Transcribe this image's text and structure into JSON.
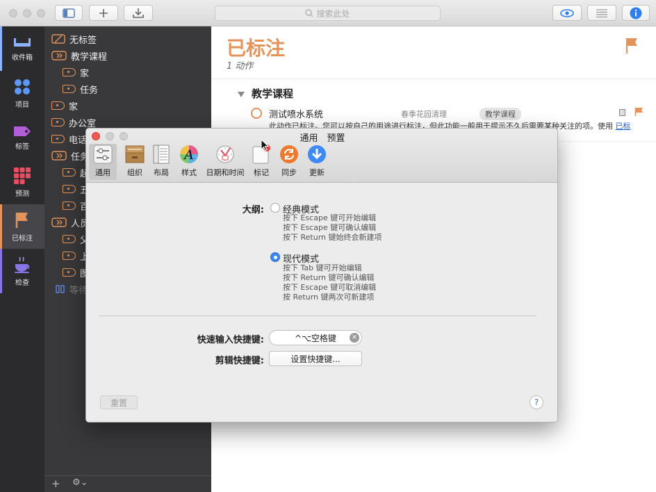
{
  "toolbar": {
    "search_placeholder": "搜索此处",
    "icons": [
      "sidebar-toggle-icon",
      "plus-icon",
      "inbox-download-icon",
      "eye-icon",
      "list-icon",
      "info-icon"
    ],
    "accent": "#2f7ff0"
  },
  "rail": {
    "items": [
      {
        "label": "收件箱",
        "icon": "inbox-icon",
        "color": "#8fb4ff"
      },
      {
        "label": "项目",
        "icon": "projects-icon",
        "color": "#5a97f7"
      },
      {
        "label": "标签",
        "icon": "tag-icon",
        "color": "#b45dd9"
      },
      {
        "label": "预测",
        "icon": "forecast-icon",
        "color": "#e84d63"
      },
      {
        "label": "已标注",
        "icon": "flag-icon",
        "color": "#e4935a"
      },
      {
        "label": "检查",
        "icon": "review-icon",
        "color": "#8a75e6"
      }
    ]
  },
  "sidebar": {
    "items": [
      {
        "label": "无标签"
      },
      {
        "label": "教学课程"
      },
      {
        "label": "家"
      },
      {
        "label": "任务"
      },
      {
        "label": "家"
      },
      {
        "label": "办公室"
      },
      {
        "label": "电话"
      },
      {
        "label": "任务"
      },
      {
        "label": "起"
      },
      {
        "label": "五"
      },
      {
        "label": "百"
      },
      {
        "label": "人员"
      },
      {
        "label": "父"
      },
      {
        "label": "上"
      },
      {
        "label": "图"
      },
      {
        "label": "等待"
      }
    ],
    "footer_add": "+",
    "footer_gear": "⚙⌄"
  },
  "main": {
    "title": "已标注",
    "subtitle": "1 动作",
    "group_title": "教学课程",
    "task": {
      "name": "测试喷水系统",
      "project": "春季花园清理",
      "tag": "教学课程",
      "note": "此动作已标注。您可以按自己的用途进行标注，但此功能一般用于提示不久后需要某种关注的项。使用",
      "note_link": "已标"
    },
    "flag_color": "#e4935a"
  },
  "dialog": {
    "title": "通用　预置",
    "tabs": [
      {
        "label": "通用",
        "icon": "general-icon"
      },
      {
        "label": "组织",
        "icon": "organization-icon"
      },
      {
        "label": "布局",
        "icon": "layout-icon"
      },
      {
        "label": "样式",
        "icon": "style-icon"
      },
      {
        "label": "日期和时间",
        "icon": "date-time-icon"
      },
      {
        "label": "标记",
        "icon": "badge-icon"
      },
      {
        "label": "同步",
        "icon": "sync-icon"
      },
      {
        "label": "更新",
        "icon": "update-icon"
      }
    ],
    "outline_label": "大纲:",
    "classic": {
      "label": "经典模式",
      "hints": [
        "按下 Escape 键可开始编辑",
        "按下 Escape 键可确认编辑",
        "按下 Return 键始终会新建项"
      ]
    },
    "modern": {
      "label": "现代模式",
      "hints": [
        "按下 Tab 键可开始编辑",
        "按下 Return 键可确认编辑",
        "按下 Escape 键可取消编辑",
        "按 Return 键两次可新建项"
      ]
    },
    "quick_entry_label": "快速输入快捷键:",
    "quick_entry_value": "^⌥空格键",
    "clipping_label": "剪辑快捷键:",
    "clipping_button": "设置快捷键...",
    "reset_label": "重置",
    "help_label": "?"
  }
}
